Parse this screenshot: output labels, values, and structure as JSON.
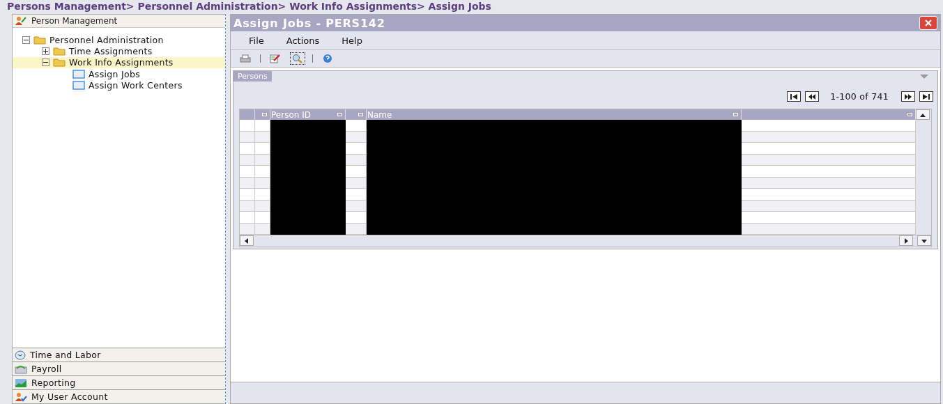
{
  "breadcrumb": "Persons Management> Personnel Administration> Work Info Assignments> Assign Jobs",
  "sidebar": {
    "title": "Person Management",
    "tree": [
      {
        "label": "Personnel Administration",
        "kind": "folder",
        "expanded": true,
        "selected": false,
        "children": [
          {
            "label": "Time Assignments",
            "kind": "folder",
            "expanded": false,
            "selected": false
          },
          {
            "label": "Work Info Assignments",
            "kind": "folder",
            "expanded": true,
            "selected": true,
            "children": [
              {
                "label": "Assign Jobs",
                "kind": "page",
                "selected": false
              },
              {
                "label": "Assign Work Centers",
                "kind": "page",
                "selected": false
              }
            ]
          }
        ]
      }
    ],
    "sections": [
      {
        "label": "Time and Labor",
        "kind": "clock"
      },
      {
        "label": "Payroll",
        "kind": "payroll"
      },
      {
        "label": "Reporting",
        "kind": "chart"
      },
      {
        "label": "My User Account",
        "kind": "user"
      }
    ]
  },
  "window": {
    "title": "Assign Jobs - PERS142",
    "menu": [
      "File",
      "Actions",
      "Help"
    ],
    "toolbar": [
      {
        "kind": "print",
        "selected": false
      },
      {
        "kind": "separator"
      },
      {
        "kind": "edit",
        "selected": false
      },
      {
        "kind": "search",
        "selected": true
      },
      {
        "kind": "separator"
      },
      {
        "kind": "help",
        "selected": false
      }
    ],
    "panel": {
      "title": "Persons",
      "pager": "1-100 of 741",
      "columns": [
        "",
        "Person ID",
        "",
        "Name",
        ""
      ],
      "rows": [
        {
          "kind": "redacted"
        },
        {
          "kind": "redacted"
        },
        {
          "kind": "redacted"
        },
        {
          "kind": "redacted"
        },
        {
          "kind": "redacted"
        },
        {
          "kind": "redacted"
        },
        {
          "kind": "redacted"
        },
        {
          "kind": "redacted"
        },
        {
          "kind": "redacted"
        },
        {
          "kind": "redacted"
        }
      ]
    }
  }
}
